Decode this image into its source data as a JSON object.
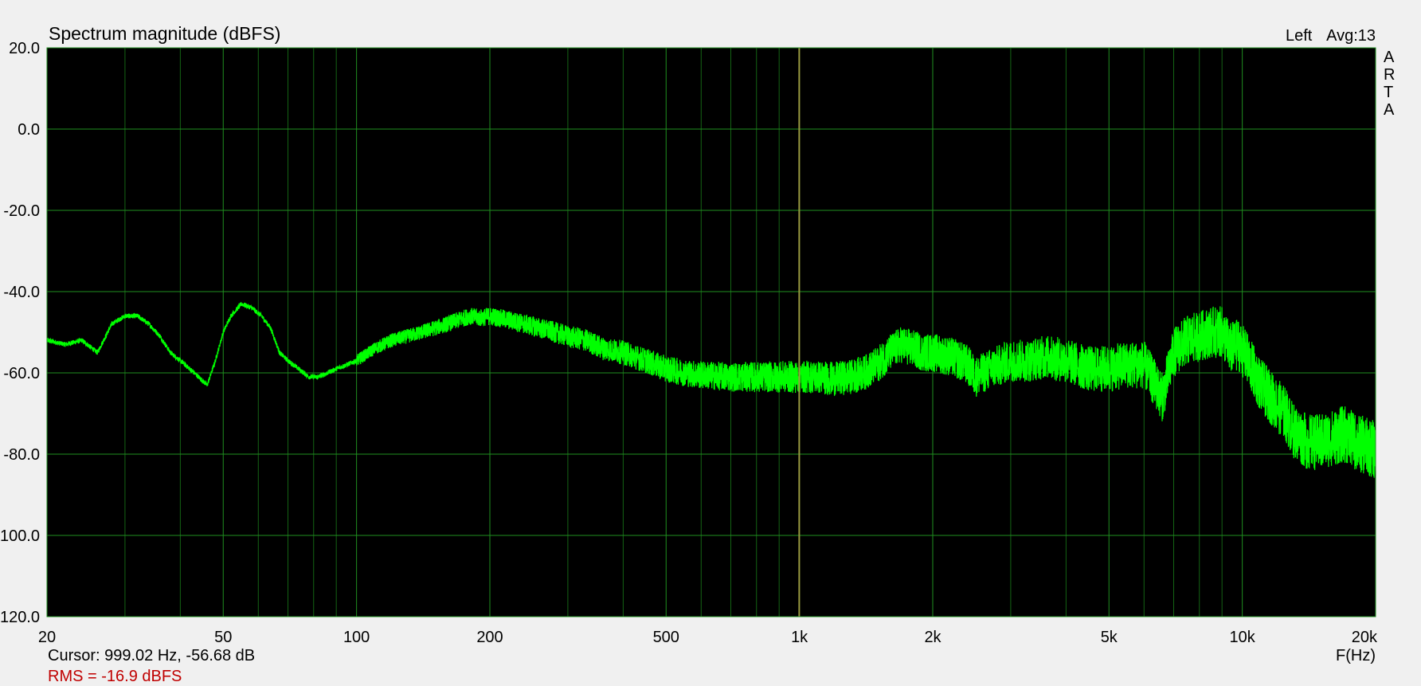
{
  "app": {
    "channel": "Left",
    "averages": "Avg:13",
    "brand_letters": [
      "A",
      "R",
      "T",
      "A"
    ],
    "cursor_readout": "Cursor: 999.02 Hz, -56.68 dB",
    "rms_readout": "RMS = -16.9 dBFS"
  },
  "colors": {
    "background": "#f0f0f0",
    "plot_background": "#000000",
    "grid_major": "#1f8f1f",
    "grid_minor": "#146414",
    "trace": "#00ff00",
    "cursor_line": "#9a9a40",
    "rms_text": "#c00000"
  },
  "chart_data": {
    "type": "line",
    "title": "Spectrum magnitude (dBFS)",
    "xlabel": "F(Hz)",
    "ylabel": "",
    "x_scale": "log",
    "xlim": [
      20,
      20000
    ],
    "ylim": [
      -120,
      20
    ],
    "grid": true,
    "x_ticks": [
      {
        "value": 20,
        "label": "20"
      },
      {
        "value": 50,
        "label": "50"
      },
      {
        "value": 100,
        "label": "100"
      },
      {
        "value": 200,
        "label": "200"
      },
      {
        "value": 500,
        "label": "500"
      },
      {
        "value": 1000,
        "label": "1k"
      },
      {
        "value": 2000,
        "label": "2k"
      },
      {
        "value": 5000,
        "label": "5k"
      },
      {
        "value": 10000,
        "label": "10k"
      },
      {
        "value": 20000,
        "label": "20k"
      }
    ],
    "y_ticks": [
      {
        "value": 20,
        "label": "20.0"
      },
      {
        "value": 0,
        "label": "0.0"
      },
      {
        "value": -20,
        "label": "-20.0"
      },
      {
        "value": -40,
        "label": "-40.0"
      },
      {
        "value": -60,
        "label": "-60.0"
      },
      {
        "value": -80,
        "label": "-80.0"
      },
      {
        "value": -100,
        "label": "-100.0"
      },
      {
        "value": -120,
        "label": "-120.0"
      }
    ],
    "cursor": {
      "frequency": 999.02,
      "level": -56.68
    },
    "series": [
      {
        "x": [
          20,
          22,
          24,
          26,
          28,
          30,
          32,
          34,
          36,
          38,
          40,
          42,
          44,
          46,
          48,
          50,
          52,
          55,
          58,
          61,
          64,
          67,
          70,
          74,
          78,
          82,
          86,
          90,
          95,
          100,
          110,
          120,
          130,
          140,
          150,
          160,
          170,
          180,
          190,
          200,
          220,
          240,
          260,
          280,
          300,
          330,
          360,
          400,
          450,
          500,
          550,
          600,
          700,
          800,
          900,
          1000,
          1100,
          1200,
          1300,
          1400,
          1500,
          1600,
          1700,
          1800,
          1900,
          2000,
          2200,
          2400,
          2500,
          2700,
          3000,
          3300,
          3600,
          4000,
          4500,
          5000,
          5500,
          6000,
          6300,
          6600,
          7000,
          7500,
          8000,
          8500,
          9000,
          9400,
          9800,
          10200,
          11000,
          12000,
          12500,
          13000,
          14000,
          15000,
          16000,
          17000,
          18000,
          19000,
          20000
        ],
        "y": [
          -52,
          -53,
          -52,
          -55,
          -48,
          -46,
          -46,
          -48,
          -51,
          -55,
          -57,
          -59,
          -61,
          -63,
          -57,
          -50,
          -46,
          -43,
          -44,
          -46,
          -49,
          -55,
          -57,
          -59,
          -61,
          -61,
          -60,
          -59,
          -58,
          -57,
          -54,
          -52,
          -51,
          -50,
          -49,
          -48,
          -47,
          -46,
          -46.5,
          -46,
          -47,
          -48,
          -49,
          -50,
          -51,
          -52,
          -54,
          -55,
          -57,
          -59,
          -60,
          -60.5,
          -61,
          -61,
          -61,
          -61,
          -61,
          -61.5,
          -61,
          -60,
          -58,
          -55,
          -53,
          -54,
          -55,
          -55,
          -56,
          -58,
          -61,
          -59,
          -57,
          -57,
          -56,
          -57,
          -59,
          -59,
          -58,
          -58,
          -62,
          -66,
          -55,
          -52,
          -51,
          -50,
          -50,
          -54,
          -53,
          -56,
          -63,
          -68,
          -70,
          -74,
          -77,
          -77,
          -76,
          -75,
          -77,
          -78,
          -79
        ]
      }
    ]
  }
}
